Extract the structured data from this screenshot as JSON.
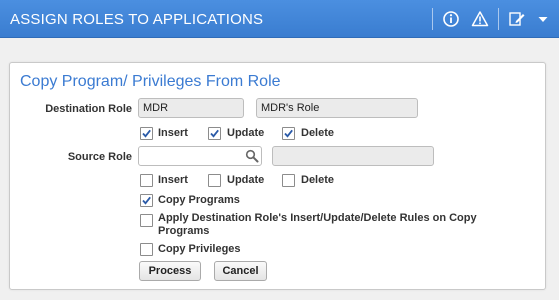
{
  "header": {
    "title": "ASSIGN ROLES TO APPLICATIONS",
    "icons": [
      "info-icon",
      "warning-icon",
      "edit-icon",
      "dropdown-arrow-icon"
    ]
  },
  "section": {
    "title": "Copy Program/ Privileges From Role"
  },
  "destination": {
    "label": "Destination Role",
    "role_code": "MDR",
    "role_name": "MDR's Role",
    "insert": {
      "label": "Insert",
      "checked": true
    },
    "update": {
      "label": "Update",
      "checked": true
    },
    "delete": {
      "label": "Delete",
      "checked": true
    }
  },
  "source": {
    "label": "Source Role",
    "role_code": "",
    "role_name": "",
    "insert": {
      "label": "Insert",
      "checked": false
    },
    "update": {
      "label": "Update",
      "checked": false
    },
    "delete": {
      "label": "Delete",
      "checked": false
    }
  },
  "options": {
    "copy_programs": {
      "label": "Copy Programs",
      "checked": true
    },
    "apply_rules": {
      "label_line1": "Apply Destination Role's Insert/Update/Delete Rules on Copy",
      "label_line2": "Programs",
      "checked": false
    },
    "copy_privileges": {
      "label": "Copy Privileges",
      "checked": false
    }
  },
  "buttons": {
    "process": "Process",
    "cancel": "Cancel"
  },
  "colors": {
    "header_bg": "#3f86dc",
    "section_title": "#3b7bd2"
  }
}
